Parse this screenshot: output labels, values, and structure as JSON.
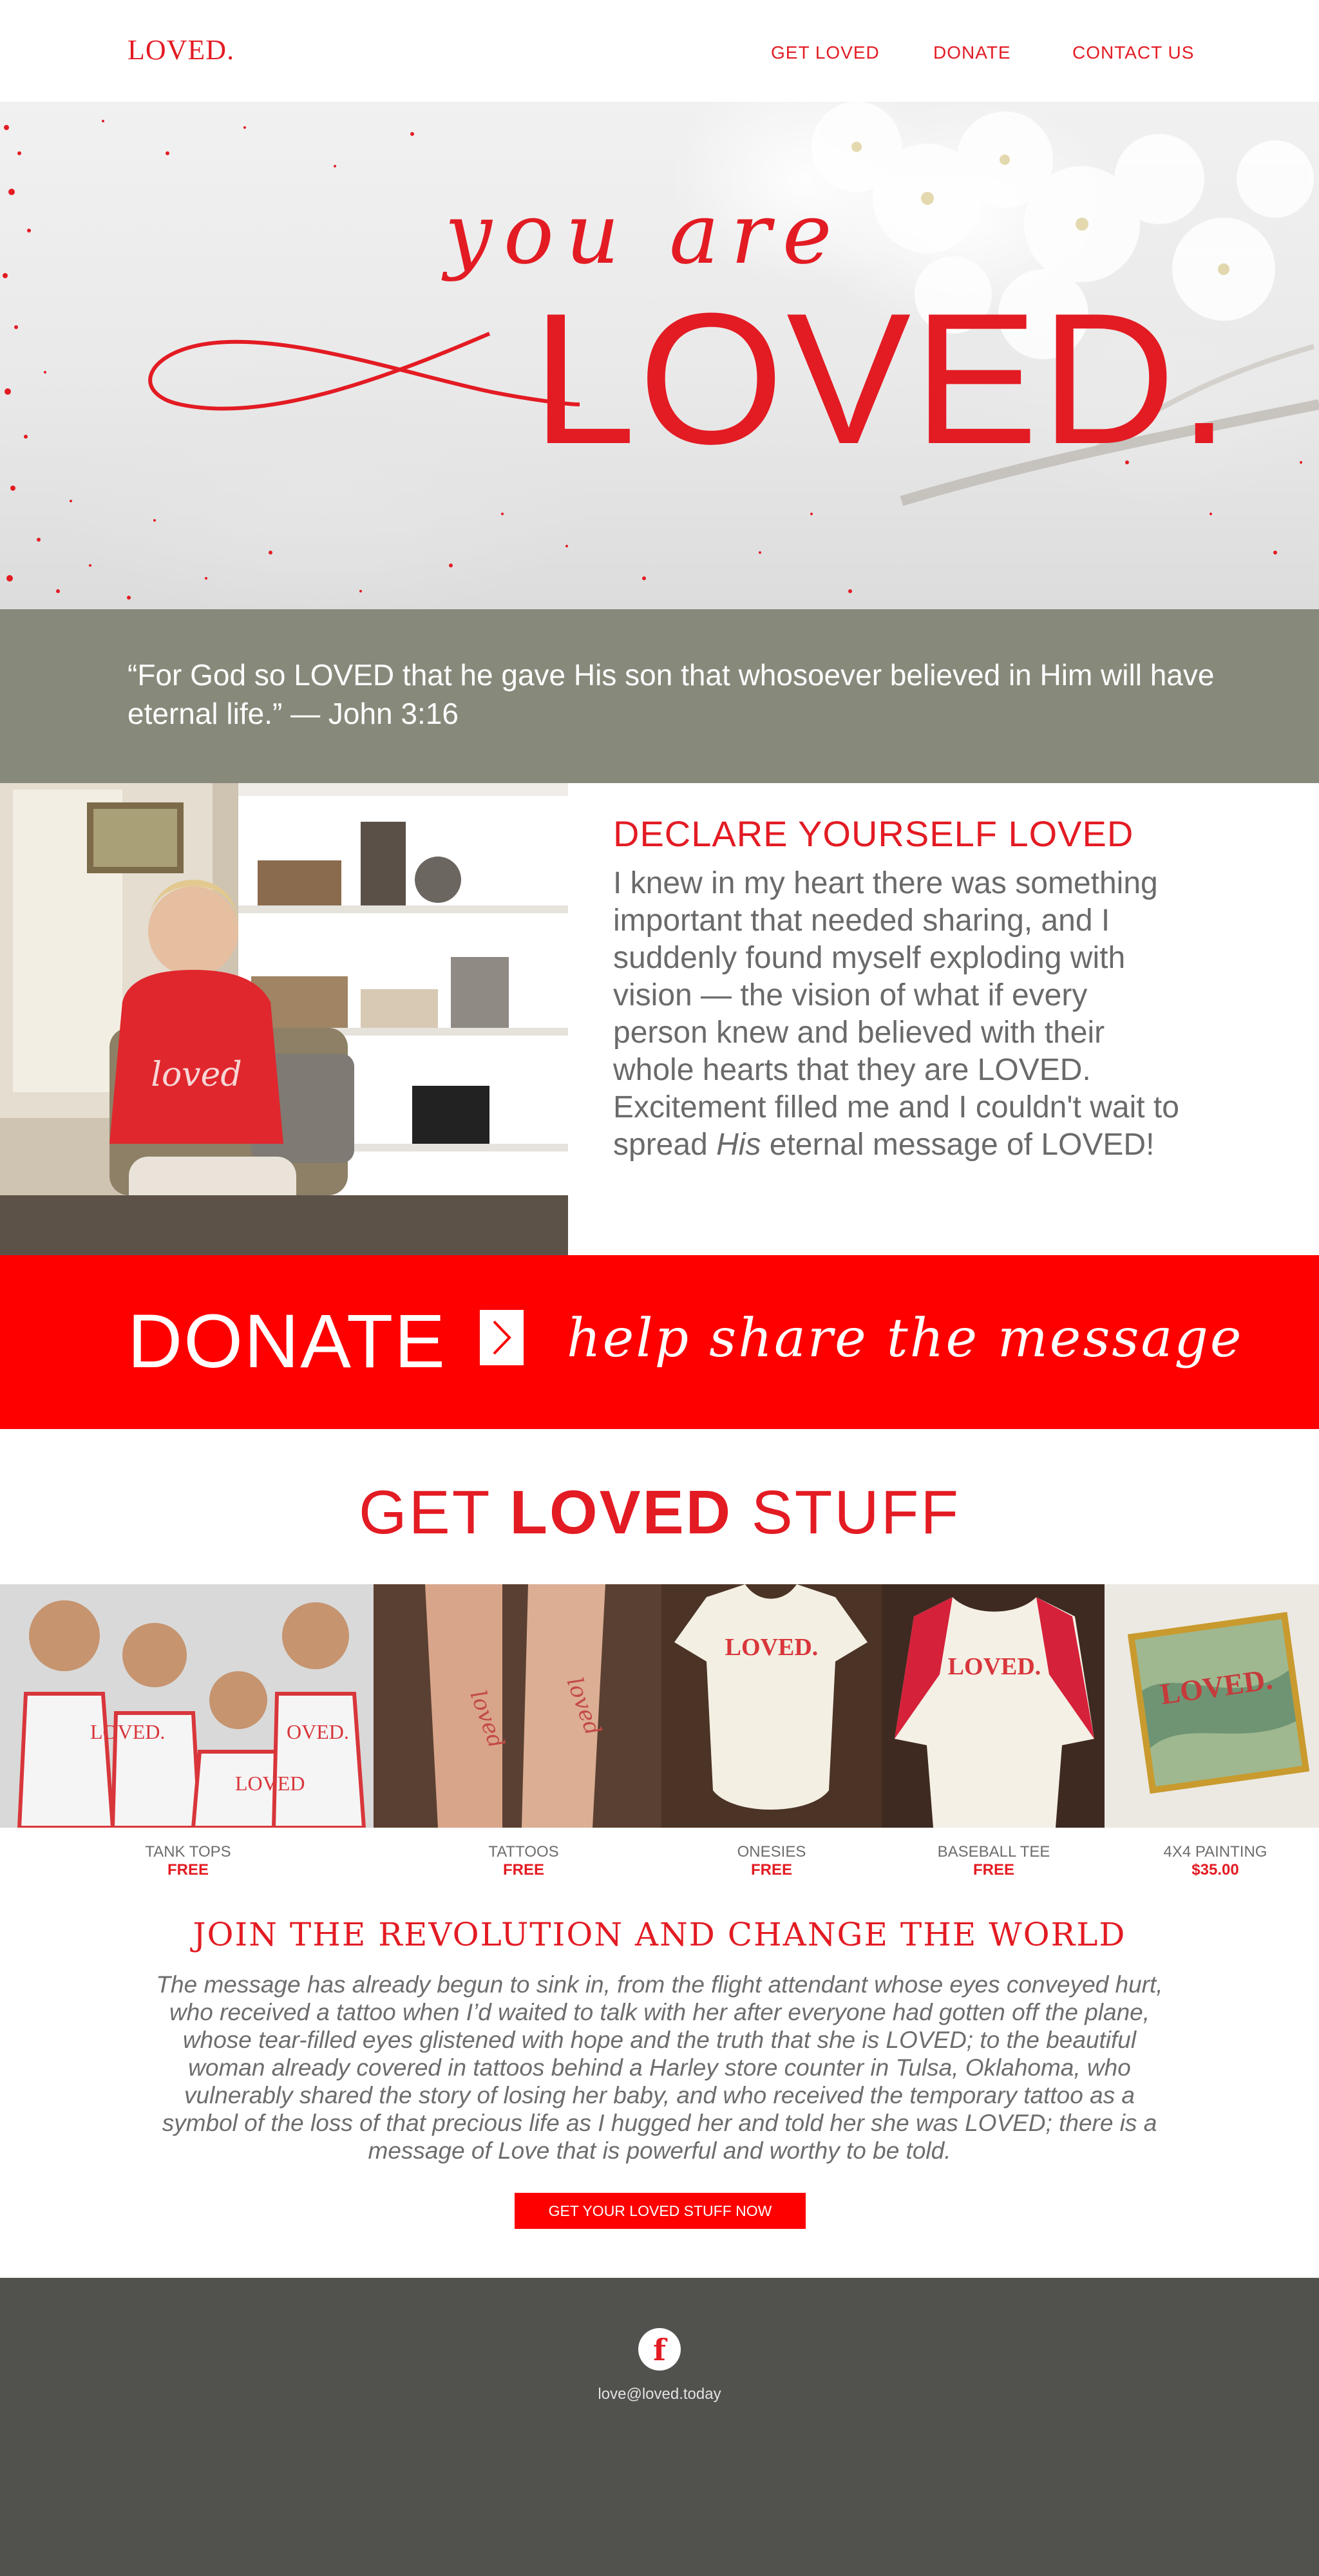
{
  "nav": {
    "logo": "LOVED.",
    "links": [
      "GET LOVED",
      "DONATE",
      "CONTACT US"
    ]
  },
  "hero": {
    "script_text": "you are",
    "main_text": "LOVED."
  },
  "verse": {
    "text": "“For God so LOVED that he gave His son that whosoever believed in Him will have eternal life.” — John 3:16"
  },
  "declare": {
    "title": "DECLARE YOURSELF LOVED",
    "body_start": "I knew in my heart there was something important that needed sharing, and I suddenly found myself exploding with vision — the vision of what if every person knew and believed with their whole hearts that they are LOVED. Excitement filled me and I couldn't wait to spread ",
    "body_em": "His",
    "body_end": " eternal message of LOVED!",
    "photo_shirt_text": "loved"
  },
  "donate": {
    "label": "DONATE",
    "tagline": "help share the message"
  },
  "stuff": {
    "title_start": "GET ",
    "title_bold": "LOVED",
    "title_end": " STUFF",
    "products": [
      {
        "name": "TANK TOPS",
        "price": "FREE",
        "img_text": "LOVED."
      },
      {
        "name": "TATTOOS",
        "price": "FREE",
        "img_text": "loved"
      },
      {
        "name": "ONESIES",
        "price": "FREE",
        "img_text": "LOVED."
      },
      {
        "name": "BASEBALL TEE",
        "price": "FREE",
        "img_text": "LOVED."
      },
      {
        "name": "4X4 PAINTING",
        "price": "$35.00",
        "img_text": "LOVED."
      }
    ]
  },
  "revolution": {
    "title": "JOIN THE REVOLUTION AND CHANGE THE WORLD",
    "body": "The message has already begun to sink in, from the flight attendant whose eyes conveyed hurt, who received a tattoo when I’d waited to talk with her after everyone had gotten off the plane, whose tear-filled eyes glistened with hope and the truth that she is LOVED; to the beautiful woman already covered in tattoos behind a Harley store counter in Tulsa, Oklahoma, who vulnerably shared the story of losing her baby, and who received the temporary tattoo as a symbol of the loss of that precious life as I hugged her and told her she was LOVED; there is a message of Love that is powerful and worthy to be told.",
    "cta": "GET YOUR LOVED STUFF NOW"
  },
  "footer": {
    "facebook_glyph": "f",
    "email": "love@loved.today"
  },
  "colors": {
    "brand_red": "#e31b23",
    "band_red": "#ff0000",
    "verse_gray": "#878a7b",
    "footer_gray": "#51524d"
  },
  "icons": [
    "chevron-right-icon",
    "facebook-icon"
  ]
}
